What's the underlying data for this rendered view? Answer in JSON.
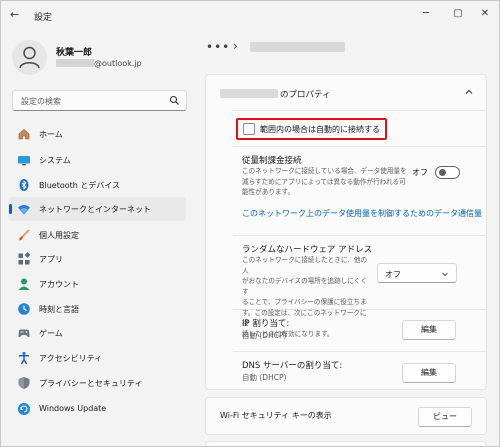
{
  "window": {
    "title": "設定",
    "back_glyph": "←",
    "minimize_glyph": "─",
    "maximize_glyph": "▢",
    "close_glyph": "✕"
  },
  "user": {
    "name": "秋葉一郎",
    "email_suffix": "@outlook.jp"
  },
  "search": {
    "placeholder": "設定の検索"
  },
  "sidebar": {
    "items": [
      {
        "label": "ホーム",
        "icon": "home-icon"
      },
      {
        "label": "システム",
        "icon": "system-icon"
      },
      {
        "label": "Bluetooth とデバイス",
        "icon": "bluetooth-icon"
      },
      {
        "label": "ネットワークとインターネット",
        "icon": "network-icon",
        "selected": true
      },
      {
        "label": "個人用設定",
        "icon": "brush-icon"
      },
      {
        "label": "アプリ",
        "icon": "apps-icon"
      },
      {
        "label": "アカウント",
        "icon": "account-icon"
      },
      {
        "label": "時刻と言語",
        "icon": "time-language-icon"
      },
      {
        "label": "ゲーム",
        "icon": "gamepad-icon"
      },
      {
        "label": "アクセシビリティ",
        "icon": "accessibility-icon"
      },
      {
        "label": "プライバシーとセキュリティ",
        "icon": "shield-icon"
      },
      {
        "label": "Windows Update",
        "icon": "windows-update-icon"
      }
    ]
  },
  "breadcrumb": {
    "dots": "•••",
    "chevron": "›"
  },
  "properties": {
    "title_suffix": "のプロパティ",
    "auto_connect_label": "範囲内の場合は自動的に接続する",
    "auto_connect_checked": false,
    "metered": {
      "title": "従量制課金接続",
      "desc": [
        "このネットワークに接続している場合、データ使用量を",
        "減らすためにアプリによっては異なる動作が行われる可",
        "能性があります。"
      ],
      "toggle_label": "オフ",
      "toggle_on": false
    },
    "data_limit_link": "このネットワーク上のデータ使用量を制御するためのデータ通信量",
    "random_hw": {
      "title": "ランダムなハードウェア アドレス",
      "desc": [
        "このネットワークに接続したときに、他の人",
        "がおなたのデバイスの場所を追跡しにくくす",
        "ることで、プライバシーの保護に役立ちま",
        "す。この設定は、次にこのネットワークに接",
        "続したときに有効になります。"
      ],
      "value": "オフ"
    },
    "ip": {
      "title": "IP 割り当て:",
      "value": "自動 (DHCP)",
      "button": "編集"
    },
    "dns": {
      "title": "DNS サーバーの割り当て:",
      "value": "自動 (DHCP)",
      "button": "編集"
    }
  },
  "wifi_security": {
    "label": "Wi-Fi セキュリティ キーの表示",
    "button": "ビュー"
  },
  "colors": {
    "accent": "#0067c0",
    "link": "#0063b1",
    "highlight": "#e0101a",
    "background": "#f3f3f3",
    "card": "#fbfbfb"
  }
}
